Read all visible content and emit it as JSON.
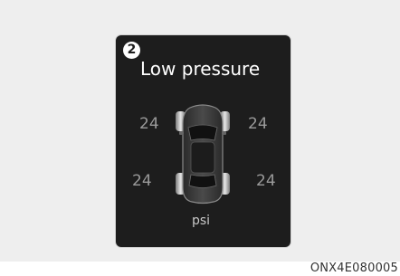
{
  "display": {
    "step_number": "2",
    "title": "Low pressure",
    "tire_pressures": {
      "front_left": "24",
      "front_right": "24",
      "rear_left": "24",
      "rear_right": "24"
    },
    "unit": "psi",
    "icon": "car-top-view-icon"
  },
  "figure_code": "ONX4E080005",
  "colors": {
    "panel_background": "#1d1d1d",
    "title_text": "#ffffff",
    "pressure_text": "#9a9a9a",
    "page_background": "#eeeeee"
  }
}
